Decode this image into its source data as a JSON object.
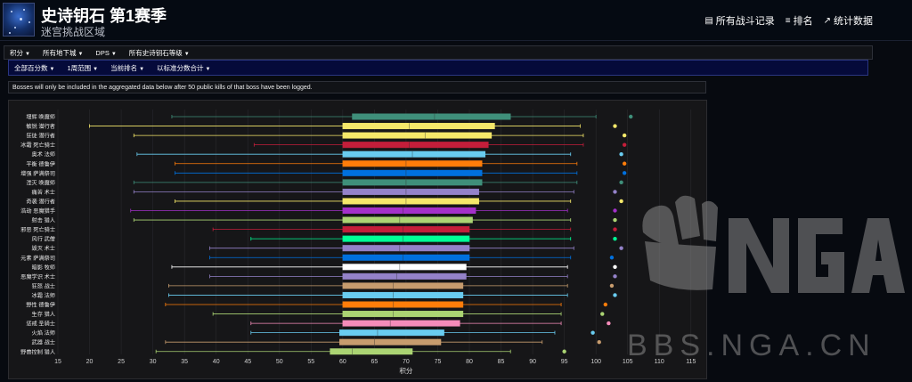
{
  "header": {
    "title": "史诗钥石 第1赛季",
    "subtitle": "迷宫挑战区域",
    "nav": [
      {
        "label": "所有战斗记录",
        "icon": "list-icon"
      },
      {
        "label": "排名",
        "icon": "ranking-icon"
      },
      {
        "label": "统计数据",
        "icon": "trend-icon"
      }
    ]
  },
  "filters_primary": [
    "积分",
    "所有地下城",
    "DPS",
    "所有史诗钥石等级"
  ],
  "filters_secondary": [
    "全部百分数",
    "1周范围",
    "当前排名",
    "以标准分数合计"
  ],
  "notice": "Bosses will only be included in the aggregated data below after 50 public kills of that boss have been logged.",
  "watermark": "BBS.NGA.CN",
  "chart_data": {
    "type": "boxplot",
    "title": "",
    "xlabel": "积分",
    "ylabel": "",
    "xlim": [
      15,
      117
    ],
    "xticks": [
      "15",
      "20",
      "25",
      "30",
      "35",
      "40",
      "45",
      "50",
      "55",
      "60",
      "65",
      "70",
      "75",
      "80",
      "85",
      "90",
      "95",
      "100",
      "105",
      "110",
      "115"
    ],
    "grid": true,
    "series": [
      {
        "name": "增辉 唤魔师",
        "min": 33,
        "q1": 61.5,
        "median": 74.5,
        "q3": 86.5,
        "max": 100,
        "top": 105.5,
        "color": "#3f8f7a"
      },
      {
        "name": "敏锐 潜行者",
        "min": 20,
        "q1": 60,
        "median": 70.5,
        "q3": 84,
        "max": 97.5,
        "top": 103,
        "color": "#f5e86a"
      },
      {
        "name": "狂徒 潜行者",
        "min": 27,
        "q1": 60,
        "median": 73,
        "q3": 83.5,
        "max": 98,
        "top": 104.5,
        "color": "#f5e86a"
      },
      {
        "name": "冰霜 死亡骑士",
        "min": 46,
        "q1": 60,
        "median": 70.5,
        "q3": 83,
        "max": 98,
        "top": 104.5,
        "color": "#c41e3a"
      },
      {
        "name": "奥术 法师",
        "min": 27.5,
        "q1": 60,
        "median": 71,
        "q3": 82.5,
        "max": 96,
        "top": 104,
        "color": "#69ccf0"
      },
      {
        "name": "平衡 德鲁伊",
        "min": 33.5,
        "q1": 60,
        "median": 70,
        "q3": 82,
        "max": 97,
        "top": 104.5,
        "color": "#ff7d0a"
      },
      {
        "name": "增强 萨满祭司",
        "min": 33.5,
        "q1": 60,
        "median": 70,
        "q3": 82,
        "max": 97,
        "top": 104.5,
        "color": "#0070de"
      },
      {
        "name": "湮灭 唤魔师",
        "min": 27,
        "q1": 60,
        "median": 70,
        "q3": 82,
        "max": 97,
        "top": 104,
        "color": "#3f8f7a"
      },
      {
        "name": "痛苦 术士",
        "min": 27,
        "q1": 60,
        "median": 70,
        "q3": 81.5,
        "max": 96.5,
        "top": 103,
        "color": "#9482c9"
      },
      {
        "name": "奇袭 潜行者",
        "min": 33.5,
        "q1": 60,
        "median": 70,
        "q3": 81.5,
        "max": 96,
        "top": 104,
        "color": "#f5e86a"
      },
      {
        "name": "浩劫 恶魔猎手",
        "min": 26.5,
        "q1": 60,
        "median": 69.5,
        "q3": 81,
        "max": 95.5,
        "top": 103,
        "color": "#a330c9"
      },
      {
        "name": "射击 猎人",
        "min": 27,
        "q1": 60,
        "median": 69,
        "q3": 80.5,
        "max": 96,
        "top": 103,
        "color": "#abd473"
      },
      {
        "name": "邪恶 死亡骑士",
        "min": 39.5,
        "q1": 60,
        "median": 69.5,
        "q3": 80,
        "max": 96,
        "top": 103,
        "color": "#c41e3a"
      },
      {
        "name": "风行 武僧",
        "min": 45.5,
        "q1": 60,
        "median": 69.5,
        "q3": 80,
        "max": 96,
        "top": 103,
        "color": "#00ff96"
      },
      {
        "name": "毁灭 术士",
        "min": 39,
        "q1": 60,
        "median": 69,
        "q3": 80,
        "max": 96.5,
        "top": 104,
        "color": "#9482c9"
      },
      {
        "name": "元素 萨满祭司",
        "min": 39,
        "q1": 60,
        "median": 69.5,
        "q3": 80,
        "max": 96,
        "top": 102.5,
        "color": "#0070de"
      },
      {
        "name": "暗影 牧师",
        "min": 33,
        "q1": 60,
        "median": 69,
        "q3": 79.5,
        "max": 95.5,
        "top": 103,
        "color": "#ffffff"
      },
      {
        "name": "恶魔学识 术士",
        "min": 39,
        "q1": 60,
        "median": 68.5,
        "q3": 79.5,
        "max": 95.5,
        "top": 103,
        "color": "#9482c9"
      },
      {
        "name": "狂怒 战士",
        "min": 32.5,
        "q1": 60,
        "median": 68,
        "q3": 79,
        "max": 95.5,
        "top": 102.5,
        "color": "#c79c6e"
      },
      {
        "name": "冰霜 法师",
        "min": 32.5,
        "q1": 60,
        "median": 68,
        "q3": 79,
        "max": 95.5,
        "top": 103,
        "color": "#69ccf0"
      },
      {
        "name": "野性 德鲁伊",
        "min": 32,
        "q1": 60,
        "median": 68,
        "q3": 79,
        "max": 94.5,
        "top": 101.5,
        "color": "#ff7d0a"
      },
      {
        "name": "生存 猎人",
        "min": 39.5,
        "q1": 60,
        "median": 68,
        "q3": 79,
        "max": 94.5,
        "top": 101,
        "color": "#abd473"
      },
      {
        "name": "惩戒 圣骑士",
        "min": 45.5,
        "q1": 60,
        "median": 67.5,
        "q3": 78.5,
        "max": 94.5,
        "top": 102,
        "color": "#f58cba"
      },
      {
        "name": "火焰 法师",
        "min": 45.5,
        "q1": 59.5,
        "median": 65.5,
        "q3": 76,
        "max": 93.5,
        "top": 99.5,
        "color": "#69ccf0"
      },
      {
        "name": "武器 战士",
        "min": 32,
        "q1": 59.5,
        "median": 65,
        "q3": 75.5,
        "max": 91.5,
        "top": 100.5,
        "color": "#c79c6e"
      },
      {
        "name": "野兽控制 猎人",
        "min": 30.5,
        "q1": 58,
        "median": 61.5,
        "q3": 71,
        "max": 86.5,
        "top": 95,
        "color": "#abd473"
      }
    ]
  }
}
